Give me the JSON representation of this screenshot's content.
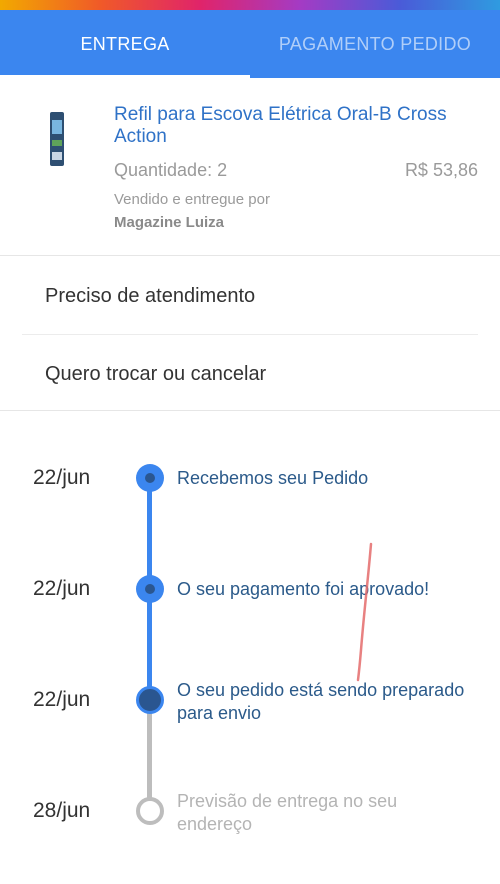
{
  "tabs": {
    "entrega_label": "ENTREGA",
    "pagamento_label": "PAGAMENTO PEDIDO"
  },
  "product": {
    "title": "Refil para Escova Elétrica Oral-B Cross Action",
    "quantity": "Quantidade: 2",
    "price": "R$ 53,86",
    "sold_by": "Vendido e entregue por",
    "seller": "Magazine Luiza"
  },
  "menu": {
    "help": "Preciso de atendimento",
    "exchange": "Quero trocar ou cancelar"
  },
  "timeline": {
    "steps": [
      {
        "date": "22/jun",
        "text": "Recebemos seu Pedido",
        "status": "done"
      },
      {
        "date": "22/jun",
        "text": "O seu pagamento foi aprovado!",
        "status": "done"
      },
      {
        "date": "22/jun",
        "text": "O seu pedido está sendo preparado para envio",
        "status": "current"
      },
      {
        "date": "28/jun",
        "text": "Previsão de entrega no seu endereço",
        "status": "pending"
      }
    ]
  },
  "colors": {
    "accent": "#3b86ef",
    "link": "#2f72c7",
    "step_text": "#2b5a8a",
    "inactive": "#bdbdbd"
  }
}
